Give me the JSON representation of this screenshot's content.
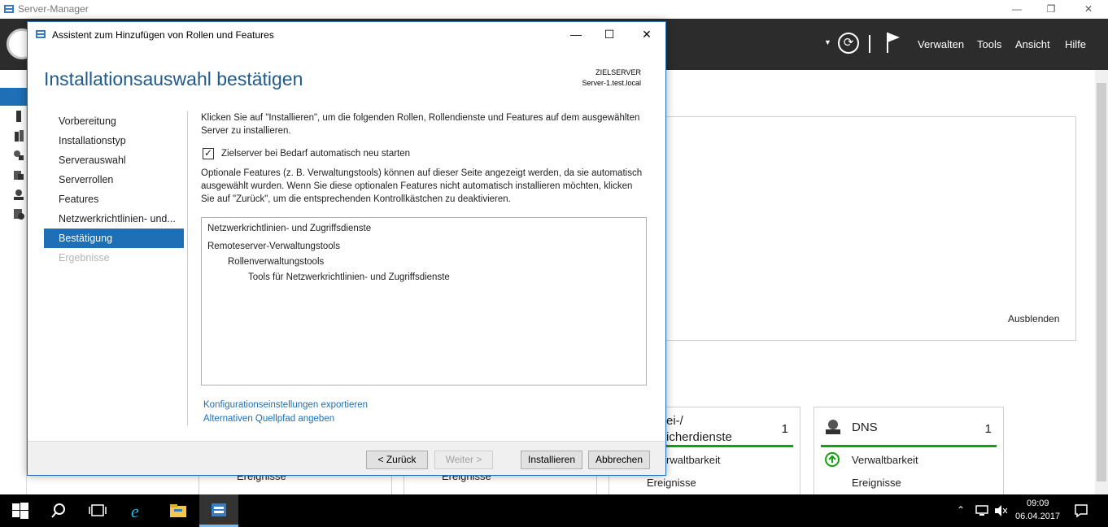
{
  "app": {
    "title": "Server-Manager"
  },
  "header": {
    "menu": [
      "Verwalten",
      "Tools",
      "Ansicht",
      "Hilfe"
    ]
  },
  "welcome": {
    "hide_link": "Ausblenden"
  },
  "tiles": [
    {
      "name": "Datei-/ Speicherdienste",
      "name_line1": "ei-/",
      "name_line2": "icherdienste",
      "count": "1",
      "row1": "rwaltbarkeit",
      "row2": "Ereignisse"
    },
    {
      "name": "DNS",
      "count": "1",
      "row1": "Verwaltbarkeit",
      "row2": "Ereignisse"
    }
  ],
  "tile_events": [
    "Ereignisse",
    "Ereignisse"
  ],
  "wizard": {
    "title": "Assistent zum Hinzufügen von Rollen und Features",
    "heading": "Installationsauswahl bestätigen",
    "target_label": "ZIELSERVER",
    "target_server": "Server-1.test.local",
    "steps": [
      {
        "label": "Vorbereitung",
        "state": "normal"
      },
      {
        "label": "Installationstyp",
        "state": "normal"
      },
      {
        "label": "Serverauswahl",
        "state": "normal"
      },
      {
        "label": "Serverrollen",
        "state": "normal"
      },
      {
        "label": "Features",
        "state": "normal"
      },
      {
        "label": "Netzwerkrichtlinien- und...",
        "state": "normal"
      },
      {
        "label": "Bestätigung",
        "state": "active"
      },
      {
        "label": "Ergebnisse",
        "state": "disabled"
      }
    ],
    "intro": "Klicken Sie auf \"Installieren\", um die folgenden Rollen, Rollendienste und Features auf dem ausgewählten Server zu installieren.",
    "restart_checked": true,
    "restart_label": "Zielserver bei Bedarf automatisch neu starten",
    "optional_text": "Optionale Features (z. B. Verwaltungstools) können auf dieser Seite angezeigt werden, da sie automatisch ausgewählt wurden. Wenn Sie diese optionalen Features nicht automatisch installieren möchten, klicken Sie auf \"Zurück\", um die entsprechenden Kontrollkästchen zu deaktivieren.",
    "selection": [
      {
        "label": "Netzwerkrichtlinien- und Zugriffsdienste",
        "level": 0
      },
      {
        "label": "Remoteserver-Verwaltungstools",
        "level": 0
      },
      {
        "label": "Rollenverwaltungstools",
        "level": 1
      },
      {
        "label": "Tools für Netzwerkrichtlinien- und Zugriffsdienste",
        "level": 2
      }
    ],
    "export_link": "Konfigurationseinstellungen exportieren",
    "altpath_link": "Alternativen Quellpfad angeben",
    "buttons": {
      "back": "< Zurück",
      "next": "Weiter >",
      "install": "Installieren",
      "cancel": "Abbrechen"
    }
  },
  "taskbar": {
    "time": "09:09",
    "date": "06.04.2017"
  },
  "colors": {
    "accent": "#1e6fb5",
    "header_bg": "#2c2c2c",
    "heading": "#1e5a8c",
    "status_green": "#13a10e"
  }
}
